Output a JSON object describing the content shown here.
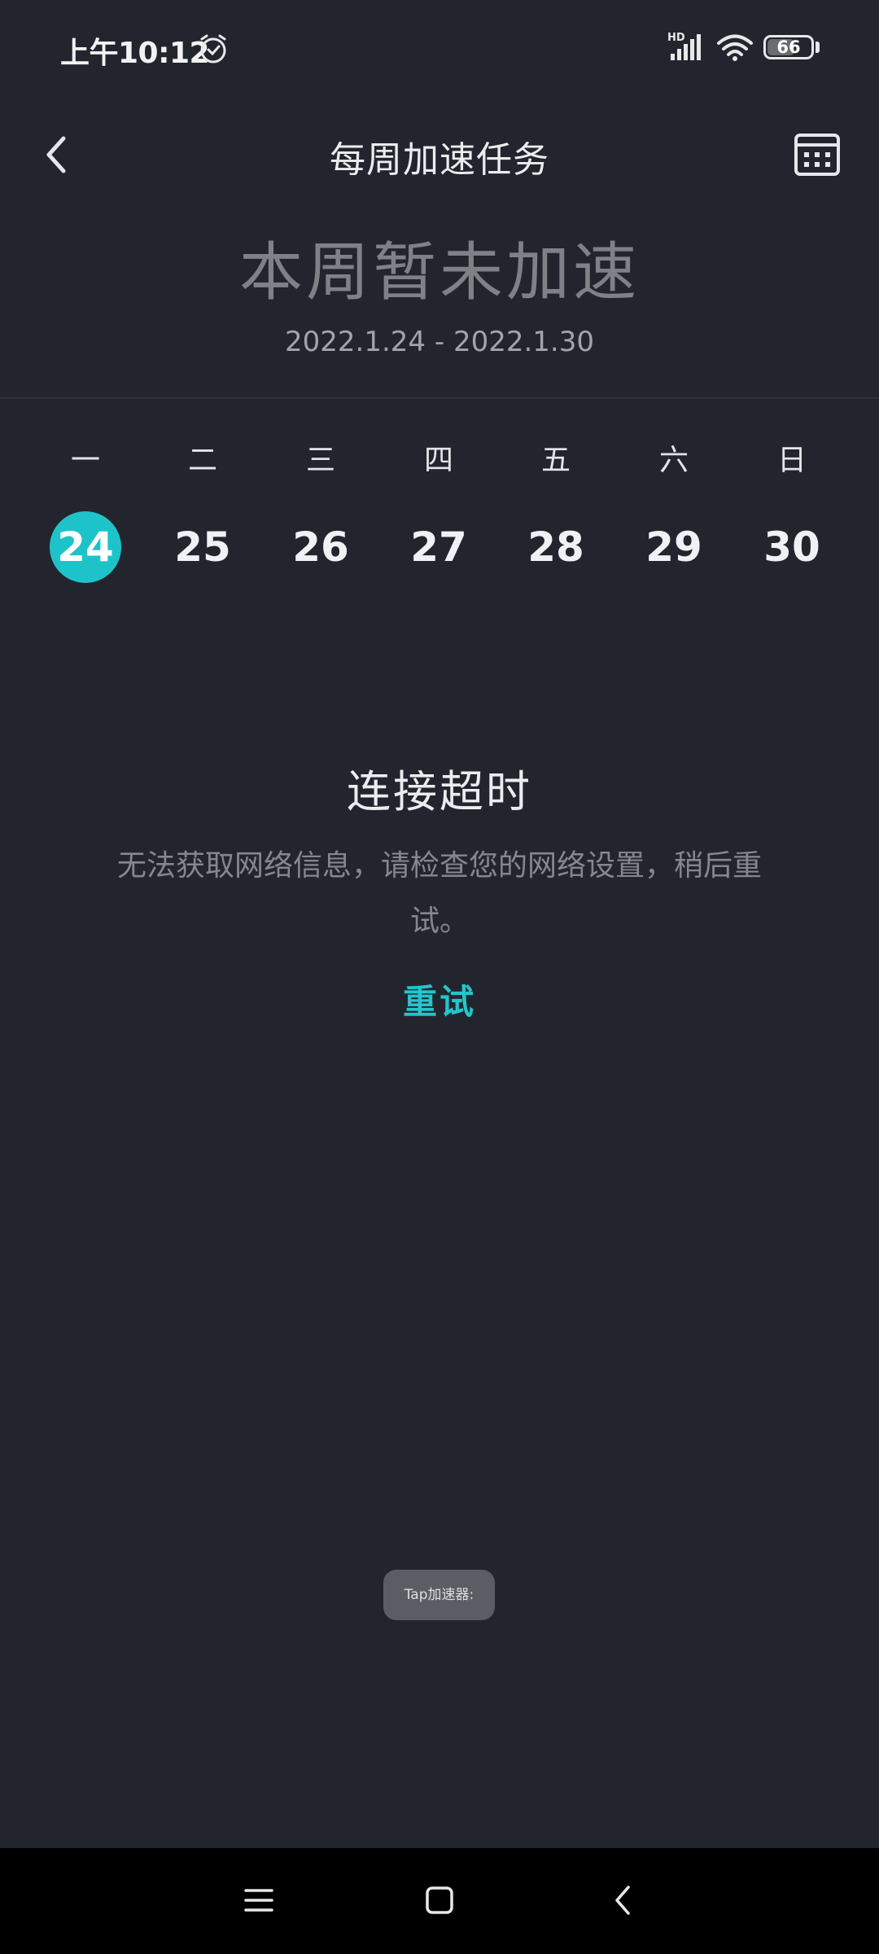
{
  "status_bar": {
    "time": "上午10:12",
    "network_label": "HD",
    "battery_level": "66"
  },
  "header": {
    "title": "每周加速任务"
  },
  "summary": {
    "status": "本周暂未加速",
    "date_range": "2022.1.24 - 2022.1.30"
  },
  "week": {
    "weekdays": [
      "一",
      "二",
      "三",
      "四",
      "五",
      "六",
      "日"
    ],
    "dates": [
      "24",
      "25",
      "26",
      "27",
      "28",
      "29",
      "30"
    ],
    "selected_index": 0
  },
  "error": {
    "title": "连接超时",
    "message": "无法获取网络信息，请检查您的网络设置，稍后重试。",
    "retry_label": "重试"
  },
  "toast": {
    "text": "Tap加速器:"
  },
  "colors": {
    "background": "#23252e",
    "accent": "#1ec3c9",
    "nav_bar": "#000000"
  },
  "icons": {
    "back": "chevron-left-icon",
    "calendar": "calendar-icon",
    "alarm": "alarm-icon",
    "signal": "signal-icon",
    "wifi": "wifi-icon",
    "battery": "battery-icon",
    "nav_menu": "menu-icon",
    "nav_home": "home-icon",
    "nav_back": "back-icon"
  }
}
